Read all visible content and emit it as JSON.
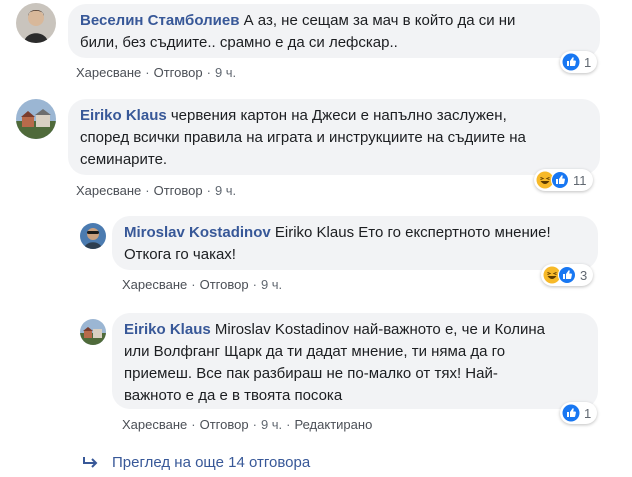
{
  "comments": [
    {
      "author": "Веселин Стамболиев",
      "text_lines": [
        " А аз, не сещам за мач в който да си ни",
        "били, без съдиите.. срамно е да си лефскар.."
      ],
      "actions": {
        "like": "Харесване",
        "reply": "Отговор",
        "time": "9 ч."
      },
      "reactions": {
        "icons": [
          "like-icon"
        ],
        "count": "1"
      }
    },
    {
      "author": "Eiriko Klaus",
      "text_lines": [
        " червения картон на Джеси е напълно заслужен,",
        "според всички правила на играта и инструкциите на съдиите на",
        "семинарите."
      ],
      "actions": {
        "like": "Харесване",
        "reply": "Отговор",
        "time": "9 ч."
      },
      "reactions": {
        "icons": [
          "haha-icon",
          "like-icon"
        ],
        "count": "11"
      }
    }
  ],
  "replies": [
    {
      "author": "Miroslav Kostadinov",
      "text_lines": [
        " Eiriko Klaus Ето го експертното мнение!",
        "Откога го чаках!"
      ],
      "actions": {
        "like": "Харесване",
        "reply": "Отговор",
        "time": "9 ч."
      },
      "reactions": {
        "icons": [
          "haha-icon",
          "like-icon"
        ],
        "count": "3"
      }
    },
    {
      "author": "Eiriko Klaus",
      "text_lines": [
        " Miroslav Kostadinov най-важното е, че и Колина",
        "или Волфганг Щарк да ти дадат мнение, ти няма да го",
        "приемеш. Все пак разбираш не по-малко от тях! Най-",
        "важното е да е в твоята посока"
      ],
      "actions": {
        "like": "Харесване",
        "reply": "Отговор",
        "time": "9 ч.",
        "edited": "Редактирано"
      },
      "reactions": {
        "icons": [
          "like-icon"
        ],
        "count": "1"
      }
    }
  ],
  "more_replies": "Преглед на още 14 отговора",
  "colors": {
    "link": "#385898",
    "bubble": "#f2f3f5",
    "like": "#1877f2",
    "haha": "#f7b928"
  }
}
